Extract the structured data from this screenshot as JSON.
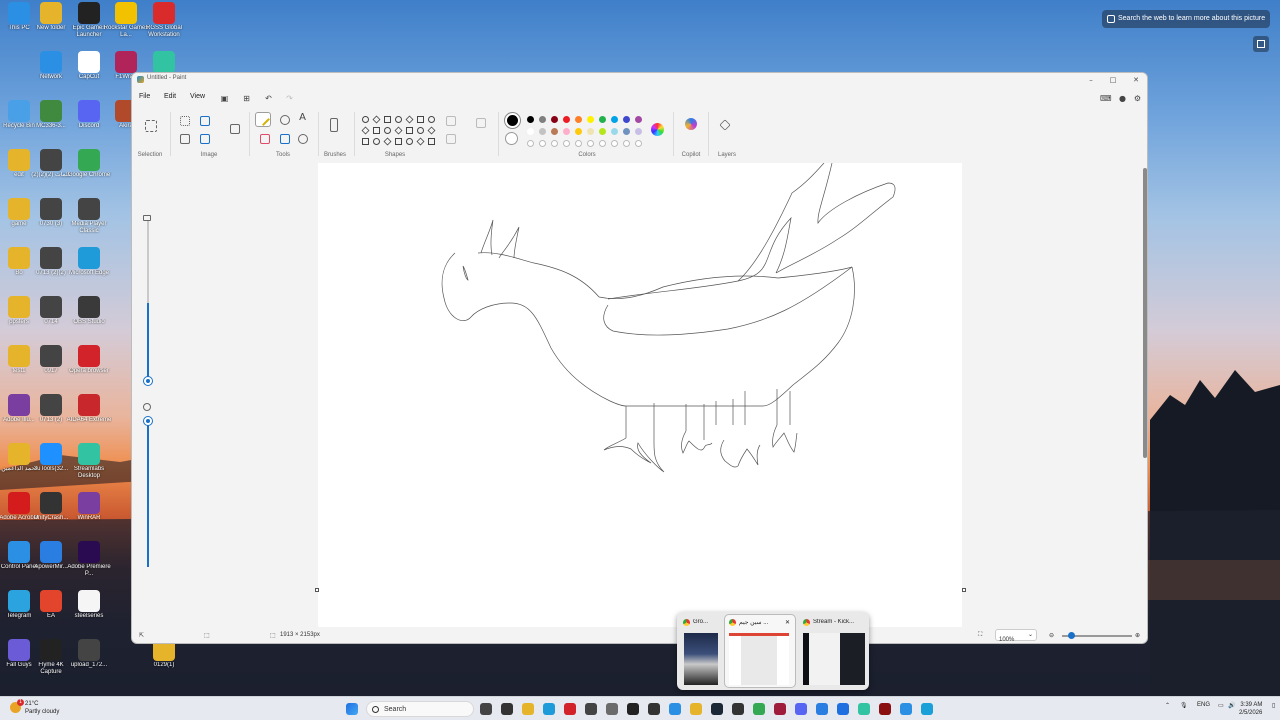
{
  "desktop": {
    "icons": [
      {
        "label": "This PC",
        "icon": "computer-icon",
        "color": "#2b8fe3"
      },
      {
        "label": "New folder",
        "icon": "folder-icon",
        "color": "#e6b42a"
      },
      {
        "label": "Epic Games Launcher",
        "icon": "epic-games-icon",
        "color": "#222222"
      },
      {
        "label": "Rockstar Games La...",
        "icon": "rockstar-icon",
        "color": "#f2c200"
      },
      {
        "label": "RGSS Global Workstation",
        "icon": "rgss-icon",
        "color": "#d92b2b"
      },
      {
        "label": "Network",
        "icon": "network-icon",
        "color": "#2b8fe3"
      },
      {
        "label": "CapCut",
        "icon": "capcut-icon",
        "color": "#ffffff"
      },
      {
        "label": "F1Wrap",
        "icon": "app-icon",
        "color": "#b0245a"
      },
      {
        "label": "Streamla...",
        "icon": "streamlabs-icon",
        "color": "#31c3a2"
      },
      {
        "label": "Recycle Bin",
        "icon": "recycle-bin-icon",
        "color": "#4aa0e6"
      },
      {
        "label": "MC336-3...",
        "icon": "image-icon",
        "color": "#3f8a3f"
      },
      {
        "label": "Discord",
        "icon": "discord-icon",
        "color": "#5865f2"
      },
      {
        "label": "Akira",
        "icon": "file-icon",
        "color": "#b04a2a"
      },
      {
        "label": "edit",
        "icon": "folder-icon",
        "color": "#e6b42a"
      },
      {
        "label": "كلمات (2)(2)(2)",
        "icon": "video-icon",
        "color": "#444444"
      },
      {
        "label": "Google Chrome",
        "icon": "chrome-icon",
        "color": "#34a853"
      },
      {
        "label": "game",
        "icon": "folder-icon",
        "color": "#e6b42a"
      },
      {
        "label": "0730 (3)",
        "icon": "video-icon",
        "color": "#444444"
      },
      {
        "label": "Media Player Classic",
        "icon": "media-player-icon",
        "color": "#444444"
      },
      {
        "label": "Bo",
        "icon": "folder-icon",
        "color": "#e6b42a"
      },
      {
        "label": "0713 (2)(2)",
        "icon": "video-icon",
        "color": "#444444"
      },
      {
        "label": "Microsoft Edge",
        "icon": "edge-icon",
        "color": "#1f9bd9"
      },
      {
        "label": "ppsters",
        "icon": "folder-icon",
        "color": "#e6b42a"
      },
      {
        "label": "0714",
        "icon": "video-icon",
        "color": "#444444"
      },
      {
        "label": "OBS Studio",
        "icon": "obs-icon",
        "color": "#3a3a3a"
      },
      {
        "label": "test1",
        "icon": "folder-icon",
        "color": "#e6b42a"
      },
      {
        "label": "0917",
        "icon": "video-icon",
        "color": "#444444"
      },
      {
        "label": "Opera browser",
        "icon": "opera-icon",
        "color": "#d2232a"
      },
      {
        "label": "Adobe Illu...",
        "icon": "winrar-icon",
        "color": "#7a3ea0"
      },
      {
        "label": "0713 (2)",
        "icon": "video-icon",
        "color": "#444444"
      },
      {
        "label": "AIDA64 Extreme",
        "icon": "aida64-icon",
        "color": "#c8282b"
      },
      {
        "label": "احمد الداعمين",
        "icon": "folder-icon",
        "color": "#e6b42a"
      },
      {
        "label": "3uTools(32...",
        "icon": "3utools-icon",
        "color": "#1e90ff"
      },
      {
        "label": "Streamlabs Desktop",
        "icon": "streamlabs-icon",
        "color": "#31c3a2"
      },
      {
        "label": "Adobe Acrobat",
        "icon": "acrobat-icon",
        "color": "#d41c1c"
      },
      {
        "label": "UnityCrash...",
        "icon": "unity-icon",
        "color": "#333333"
      },
      {
        "label": "WinRAR",
        "icon": "winrar-icon",
        "color": "#7a3ea0"
      },
      {
        "label": "Control Panel",
        "icon": "control-panel-icon",
        "color": "#2b8fe3"
      },
      {
        "label": "ApowerMir...",
        "icon": "apowermirror-icon",
        "color": "#2a7de1"
      },
      {
        "label": "Adobe Premiere P...",
        "icon": "premiere-icon",
        "color": "#2a0a50"
      },
      {
        "label": "Telegram",
        "icon": "telegram-icon",
        "color": "#2aa3df"
      },
      {
        "label": "EA",
        "icon": "ea-icon",
        "color": "#e3452c"
      },
      {
        "label": "steelseries",
        "icon": "file-icon",
        "color": "#f5f5f5"
      },
      {
        "label": "Fall Guys",
        "icon": "fall-guys-icon",
        "color": "#6b5bd6"
      },
      {
        "label": "Flyme 4K Capture",
        "icon": "4k-icon",
        "color": "#222222"
      },
      {
        "label": "upload_172...",
        "icon": "video-icon",
        "color": "#444444"
      },
      {
        "label": "0129(1)",
        "icon": "folder-icon",
        "color": "#e6b42a"
      }
    ]
  },
  "web_search": {
    "label": "Search the web to learn more about this picture"
  },
  "paint": {
    "title": "Untitled - Paint",
    "menus": [
      "File",
      "Edit",
      "View"
    ],
    "groups": {
      "selection": "Selection",
      "image": "Image",
      "tools": "Tools",
      "brushes": "Brushes",
      "shapes": "Shapes",
      "colors": "Colors",
      "copilot": "Copilot",
      "layers": "Layers"
    },
    "palette_row1": [
      "#000000",
      "#7f7f7f",
      "#880015",
      "#ed1c24",
      "#ff7f27",
      "#fff200",
      "#22b14c",
      "#00a2e8",
      "#3f48cc",
      "#a349a4"
    ],
    "palette_row2": [
      "#ffffff",
      "#c3c3c3",
      "#b97a57",
      "#ffaec9",
      "#ffc90e",
      "#efe4b0",
      "#b5e61d",
      "#99d9ea",
      "#7092be",
      "#c8bfe7"
    ],
    "primary_color": "#000000",
    "secondary_color": "#ffffff",
    "status": {
      "canvas_size": "1913 × 2153px",
      "zoom": "100%"
    }
  },
  "taskbar_preview": {
    "windows": [
      {
        "title": "Gro..."
      },
      {
        "title": "سين جيم ..."
      },
      {
        "title": "Stream - Kick..."
      }
    ]
  },
  "taskbar": {
    "weather_temp": "21°C",
    "weather_desc": "Partly cloudy",
    "notification_count": "1",
    "search_placeholder": "Search",
    "language": "ENG",
    "time": "3:39 AM",
    "date": "2/5/2026"
  }
}
